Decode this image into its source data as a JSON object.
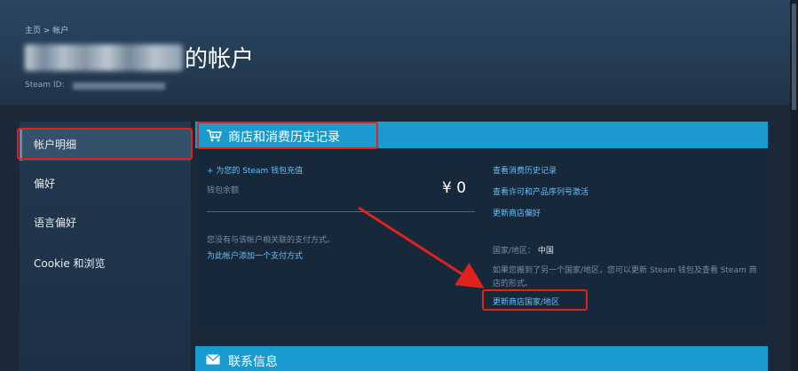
{
  "header": {
    "breadcrumb": "主页 > 帐户",
    "account_title": "的帐户",
    "steam_id_label": "Steam ID:"
  },
  "sidebar": {
    "items": [
      {
        "label": "帐户明细"
      },
      {
        "label": "偏好"
      },
      {
        "label": "语言偏好"
      },
      {
        "label": "Cookie 和浏览"
      }
    ]
  },
  "store_panel": {
    "icon": "cart-icon",
    "title": "商店和消费历史记录",
    "add_funds_link": "+ 为您的 Steam 钱包充值",
    "wallet_label": "钱包余额",
    "wallet_balance": "¥ 0",
    "no_payment_text": "您没有与该帐户相关联的支付方式。",
    "add_payment_link": "为此帐户添加一个支付方式",
    "right_links": [
      "查看消费历史记录",
      "查看许可和产品序列号激活",
      "更新商店偏好"
    ],
    "country_label": "国家/地区：",
    "country_value": "中国",
    "country_note": "如果您搬到了另一个国家/地区，您可以更新 Steam 钱包及查看 Steam 商店的形式。",
    "update_country_link": "更新商店国家/地区"
  },
  "contact_panel": {
    "icon": "mail-icon",
    "title": "联系信息"
  },
  "colors": {
    "page_bg": "#1b2838",
    "accent_blue": "#1a9bd0",
    "link": "#66c0f4",
    "annotation_red": "#e0221c"
  }
}
